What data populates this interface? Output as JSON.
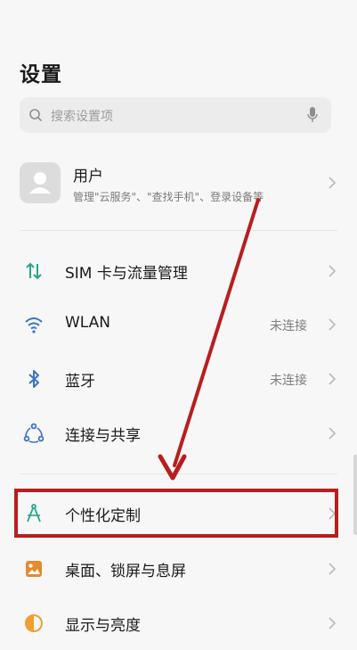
{
  "page": {
    "title": "设置"
  },
  "search": {
    "placeholder": "搜索设置项"
  },
  "user": {
    "name": "用户",
    "subtitle": "管理\"云服务\"、\"查找手机\"、登录设备等"
  },
  "items": [
    {
      "label": "SIM 卡与流量管理",
      "value": "",
      "icon": "sim-data-icon",
      "icon_color": "#27a58a"
    },
    {
      "label": "WLAN",
      "value": "未连接",
      "icon": "wifi-icon",
      "icon_color": "#3b73c8"
    },
    {
      "label": "蓝牙",
      "value": "未连接",
      "icon": "bluetooth-icon",
      "icon_color": "#3b73c8"
    },
    {
      "label": "连接与共享",
      "value": "",
      "icon": "share-icon",
      "icon_color": "#3b73c8"
    },
    {
      "label": "个性化定制",
      "value": "",
      "icon": "compass-icon",
      "icon_color": "#27a58a"
    },
    {
      "label": "桌面、锁屏与息屏",
      "value": "",
      "icon": "wallpaper-icon",
      "icon_color": "#e58a2f"
    },
    {
      "label": "显示与亮度",
      "value": "",
      "icon": "brightness-icon",
      "icon_color": "#f0a030"
    }
  ],
  "annotation": {
    "color": "#b81e1e"
  }
}
